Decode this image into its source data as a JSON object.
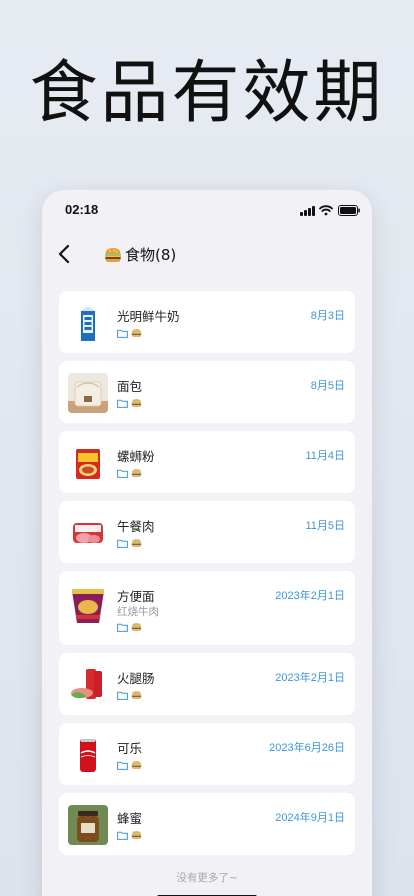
{
  "promo": {
    "title": "食品有效期"
  },
  "status_bar": {
    "time": "02:18"
  },
  "nav": {
    "title": "食物(8)",
    "category_icon": "hamburger-icon",
    "back_icon": "chevron-left-icon"
  },
  "items": [
    {
      "name": "光明鲜牛奶",
      "date": "8月3日",
      "subtitle": "",
      "image": "milk-carton"
    },
    {
      "name": "面包",
      "date": "8月5日",
      "subtitle": "",
      "image": "bread-loaf"
    },
    {
      "name": "螺蛳粉",
      "date": "11月4日",
      "subtitle": "",
      "image": "noodle-package"
    },
    {
      "name": "午餐肉",
      "date": "11月5日",
      "subtitle": "",
      "image": "luncheon-meat"
    },
    {
      "name": "方便面",
      "date": "2023年2月1日",
      "subtitle": "红烧牛肉",
      "image": "instant-noodle-cup"
    },
    {
      "name": "火腿肠",
      "date": "2023年2月1日",
      "subtitle": "",
      "image": "ham-sausage"
    },
    {
      "name": "可乐",
      "date": "2023年6月26日",
      "subtitle": "",
      "image": "cola-can"
    },
    {
      "name": "蜂蜜",
      "date": "2024年9月1日",
      "subtitle": "",
      "image": "honey-jar"
    }
  ],
  "footer": {
    "note": "没有更多了~"
  },
  "colors": {
    "date": "#3e97d9",
    "background": "#f1f1f6",
    "card": "#ffffff"
  }
}
